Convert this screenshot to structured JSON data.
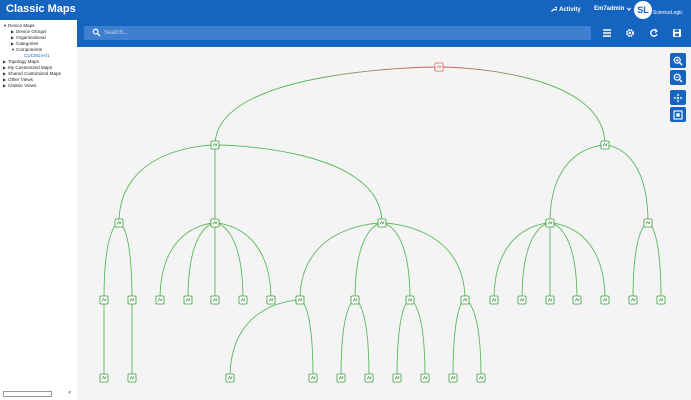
{
  "app": {
    "title": "Classic Maps"
  },
  "header": {
    "activity_label": "Activity",
    "user_label": "Em7admin",
    "logo_text": "ScienceLogic"
  },
  "sidebar": {
    "tree": [
      {
        "label": "Device Maps",
        "level": 0,
        "state": "open"
      },
      {
        "label": "Device Groups",
        "level": 1,
        "state": "closed"
      },
      {
        "label": "Organizational",
        "level": 1,
        "state": "closed"
      },
      {
        "label": "Categories",
        "level": 1,
        "state": "closed"
      },
      {
        "label": "Components",
        "level": 1,
        "state": "open"
      },
      {
        "label": "CUCM14-01",
        "level": 2,
        "state": "leaf",
        "selected": true
      },
      {
        "label": "Topology Maps",
        "level": 0,
        "state": "closed"
      },
      {
        "label": "My Customized Maps",
        "level": 0,
        "state": "closed"
      },
      {
        "label": "Shared Customized Maps",
        "level": 0,
        "state": "closed"
      },
      {
        "label": "Other Views",
        "level": 0,
        "state": "closed"
      },
      {
        "label": "Classic Views",
        "level": 0,
        "state": "closed"
      }
    ]
  },
  "search": {
    "placeholder": "Search..."
  },
  "colors": {
    "brand": "#1565c0",
    "link_ok": "#5cb85c",
    "link_critical": "#d9534f",
    "node_border": "#3a9a3a",
    "node_critical": "#d9534f"
  },
  "icons": {
    "activity": "wrench-icon",
    "user_menu": "chevron-down-icon",
    "search": "search-icon",
    "list": "list-icon",
    "settings": "gear-icon",
    "refresh": "refresh-icon",
    "save": "save-icon",
    "zoom_in": "zoom-in-icon",
    "zoom_out": "zoom-out-icon",
    "pan": "move-icon",
    "fit": "fit-icon"
  },
  "topology": {
    "nodes": [
      {
        "id": "root",
        "status": "critical"
      },
      {
        "id": "a",
        "status": "ok"
      },
      {
        "id": "b",
        "status": "ok"
      },
      {
        "id": "a1",
        "status": "ok"
      },
      {
        "id": "a2",
        "status": "ok"
      },
      {
        "id": "a3",
        "status": "ok"
      },
      {
        "id": "b1",
        "status": "ok"
      },
      {
        "id": "b2",
        "status": "ok"
      },
      {
        "id": "a1c1",
        "status": "ok"
      },
      {
        "id": "a1c2",
        "status": "ok"
      },
      {
        "id": "a2c1",
        "status": "ok"
      },
      {
        "id": "a2c2",
        "status": "ok"
      },
      {
        "id": "a2c3",
        "status": "ok"
      },
      {
        "id": "a2c4",
        "status": "ok"
      },
      {
        "id": "a2c5",
        "status": "ok"
      },
      {
        "id": "a3c1",
        "status": "ok"
      },
      {
        "id": "a3c2",
        "status": "ok"
      },
      {
        "id": "a3c3",
        "status": "ok"
      },
      {
        "id": "a3c4",
        "status": "ok"
      },
      {
        "id": "b1c1",
        "status": "ok"
      },
      {
        "id": "b1c2",
        "status": "ok"
      },
      {
        "id": "b1c3",
        "status": "ok"
      },
      {
        "id": "b1c4",
        "status": "ok"
      },
      {
        "id": "b1c5",
        "status": "ok"
      },
      {
        "id": "b2c1",
        "status": "ok"
      },
      {
        "id": "b2c2",
        "status": "ok"
      },
      {
        "id": "l1",
        "status": "ok"
      },
      {
        "id": "l2",
        "status": "ok"
      },
      {
        "id": "l3",
        "status": "ok"
      },
      {
        "id": "l4",
        "status": "ok"
      },
      {
        "id": "l5",
        "status": "ok"
      },
      {
        "id": "l6",
        "status": "ok"
      },
      {
        "id": "l7",
        "status": "ok"
      },
      {
        "id": "l8",
        "status": "ok"
      },
      {
        "id": "l9",
        "status": "ok"
      },
      {
        "id": "l10",
        "status": "ok"
      }
    ],
    "links": [
      {
        "from": "root",
        "to": "a",
        "status": "critical"
      },
      {
        "from": "root",
        "to": "b",
        "status": "critical"
      },
      {
        "from": "a",
        "to": "a1",
        "status": "ok"
      },
      {
        "from": "a",
        "to": "a2",
        "status": "ok"
      },
      {
        "from": "a",
        "to": "a3",
        "status": "ok"
      },
      {
        "from": "b",
        "to": "b1",
        "status": "ok"
      },
      {
        "from": "b",
        "to": "b2",
        "status": "ok"
      },
      {
        "from": "a1",
        "to": "a1c1",
        "status": "ok"
      },
      {
        "from": "a1",
        "to": "a1c2",
        "status": "ok"
      },
      {
        "from": "a2",
        "to": "a2c1",
        "status": "ok"
      },
      {
        "from": "a2",
        "to": "a2c2",
        "status": "ok"
      },
      {
        "from": "a2",
        "to": "a2c3",
        "status": "ok"
      },
      {
        "from": "a2",
        "to": "a2c4",
        "status": "ok"
      },
      {
        "from": "a2",
        "to": "a2c5",
        "status": "ok"
      },
      {
        "from": "a3",
        "to": "a3c1",
        "status": "ok"
      },
      {
        "from": "a3",
        "to": "a3c2",
        "status": "ok"
      },
      {
        "from": "a3",
        "to": "a3c3",
        "status": "ok"
      },
      {
        "from": "a3",
        "to": "a3c4",
        "status": "ok"
      },
      {
        "from": "b1",
        "to": "b1c1",
        "status": "ok"
      },
      {
        "from": "b1",
        "to": "b1c2",
        "status": "ok"
      },
      {
        "from": "b1",
        "to": "b1c3",
        "status": "ok"
      },
      {
        "from": "b1",
        "to": "b1c4",
        "status": "ok"
      },
      {
        "from": "b1",
        "to": "b1c5",
        "status": "ok"
      },
      {
        "from": "b2",
        "to": "b2c1",
        "status": "ok"
      },
      {
        "from": "b2",
        "to": "b2c2",
        "status": "ok"
      },
      {
        "from": "a1c1",
        "to": "l1",
        "status": "ok"
      },
      {
        "from": "a1c2",
        "to": "l2",
        "status": "ok"
      },
      {
        "from": "a3c1",
        "to": "l3",
        "status": "ok"
      },
      {
        "from": "a3c1",
        "to": "l4",
        "status": "ok"
      },
      {
        "from": "a3c2",
        "to": "l5",
        "status": "ok"
      },
      {
        "from": "a3c2",
        "to": "l6",
        "status": "ok"
      },
      {
        "from": "a3c3",
        "to": "l7",
        "status": "ok"
      },
      {
        "from": "a3c3",
        "to": "l8",
        "status": "ok"
      },
      {
        "from": "a3c4",
        "to": "l9",
        "status": "ok"
      },
      {
        "from": "a3c4",
        "to": "l10",
        "status": "ok"
      }
    ]
  }
}
